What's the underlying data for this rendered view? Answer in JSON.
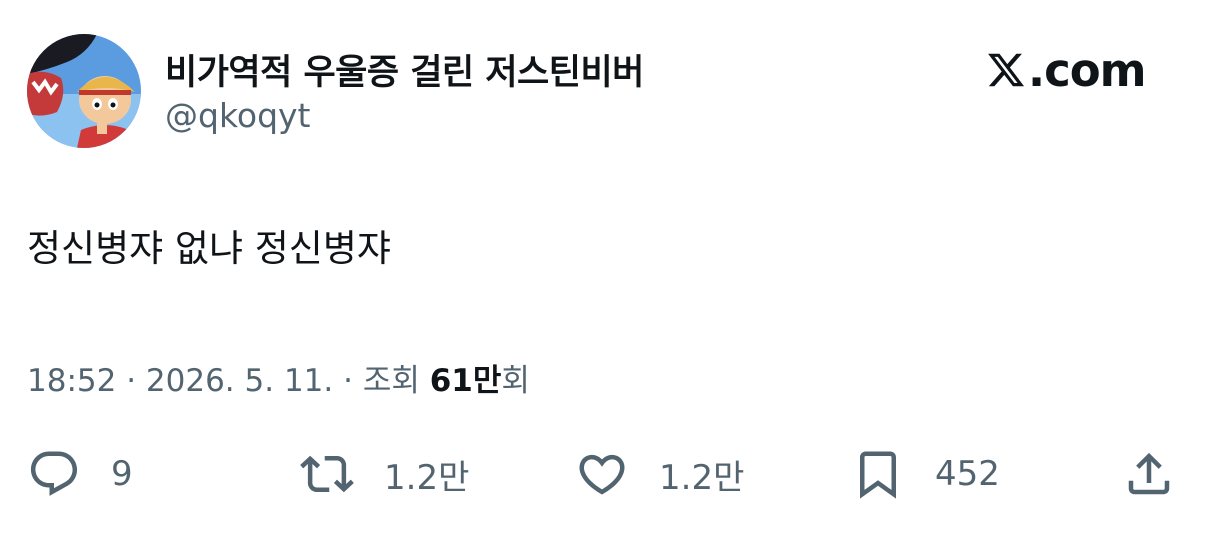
{
  "tweet": {
    "author": {
      "display_name": "비가역적 우울증 걸린 저스틴비버",
      "handle": "@qkoqyt"
    },
    "brand": ".com",
    "text": "정신병쟈 없냐 정신병쟈",
    "meta": {
      "time": "18:52",
      "date": "2026. 5. 11.",
      "views_label": "조회",
      "views_count": "61만",
      "views_suffix": "회",
      "separator": " · "
    },
    "actions": {
      "replies": "9",
      "retweets": "1.2만",
      "likes": "1.2만",
      "bookmarks": "452"
    }
  },
  "colors": {
    "text_primary": "#0f1419",
    "text_secondary": "#536471",
    "icon": "#536471"
  },
  "icons": {
    "reply": "speech-bubble-icon",
    "retweet": "retweet-icon",
    "like": "heart-icon",
    "bookmark": "bookmark-icon",
    "share": "share-icon",
    "brand": "x-logo-icon"
  }
}
